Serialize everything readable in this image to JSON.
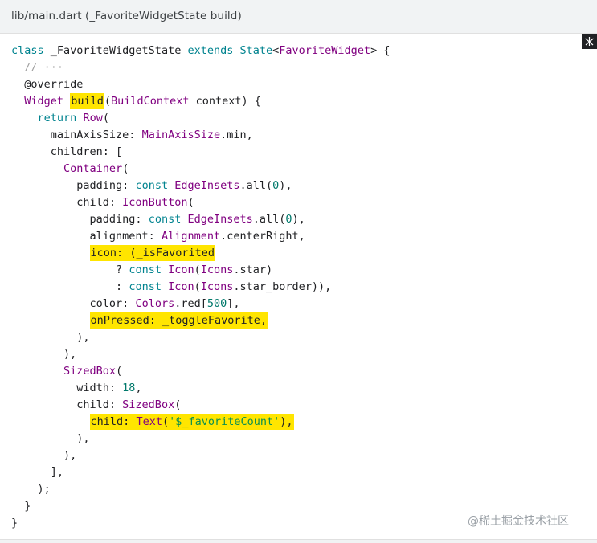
{
  "header": {
    "title": "lib/main.dart (_FavoriteWidgetState build)"
  },
  "copy_button": {
    "icon": "copy-icon"
  },
  "watermark": {
    "text": "@稀土掘金技术社区"
  },
  "code": {
    "l1": {
      "kw1": "class",
      "name": " _FavoriteWidgetState ",
      "kw2": "extends",
      "sp": " ",
      "ty1": "State",
      "lt": "<",
      "ty2": "FavoriteWidget",
      "end": "> {"
    },
    "l2": {
      "comment": "  // ···"
    },
    "l3": {
      "text": "  @override"
    },
    "l4": {
      "indent": "  ",
      "ty": "Widget",
      "sp": " ",
      "hl": "build",
      "open": "(",
      "ty2": "BuildContext",
      "end": " context) {"
    },
    "l5": {
      "indent": "    ",
      "kw": "return",
      "sp": " ",
      "ty": "Row",
      "end": "("
    },
    "l6": {
      "indent": "      mainAxisSize: ",
      "ty": "MainAxisSize",
      "end": ".min,"
    },
    "l7": {
      "text": "      children: ["
    },
    "l8": {
      "indent": "        ",
      "ty": "Container",
      "end": "("
    },
    "l9": {
      "indent": "          padding: ",
      "kw": "const",
      "sp": " ",
      "ty": "EdgeInsets",
      "mid": ".all(",
      "num": "0",
      "end": "),"
    },
    "l10": {
      "indent": "          child: ",
      "ty": "IconButton",
      "end": "("
    },
    "l11": {
      "indent": "            padding: ",
      "kw": "const",
      "sp": " ",
      "ty": "EdgeInsets",
      "mid": ".all(",
      "num": "0",
      "end": "),"
    },
    "l12": {
      "indent": "            alignment: ",
      "ty": "Alignment",
      "end": ".centerRight,"
    },
    "l13": {
      "indent": "            ",
      "hl": "icon: (_isFavorited"
    },
    "l14": {
      "indent": "                ? ",
      "kw": "const",
      "sp": " ",
      "ty": "Icon",
      "open": "(",
      "ty2": "Icons",
      "end": ".star)"
    },
    "l15": {
      "indent": "                : ",
      "kw": "const",
      "sp": " ",
      "ty": "Icon",
      "open": "(",
      "ty2": "Icons",
      "end": ".star_border)),"
    },
    "l16": {
      "indent": "            color: ",
      "ty": "Colors",
      "mid": ".red[",
      "num": "500",
      "end": "],"
    },
    "l17": {
      "indent": "            ",
      "hl": "onPressed: _toggleFavorite,"
    },
    "l18": {
      "text": "          ),"
    },
    "l19": {
      "text": "        ),"
    },
    "l20": {
      "indent": "        ",
      "ty": "SizedBox",
      "end": "("
    },
    "l21": {
      "indent": "          width: ",
      "num": "18",
      "end": ","
    },
    "l22": {
      "indent": "          child: ",
      "ty": "SizedBox",
      "end": "("
    },
    "l23": {
      "indent": "            ",
      "hl1": "child: ",
      "hl_ty": "Text",
      "hl2": "(",
      "hl_str": "'$_favoriteCount'",
      "hl3": "),"
    },
    "l24": {
      "text": "          ),"
    },
    "l25": {
      "text": "        ),"
    },
    "l26": {
      "text": "      ],"
    },
    "l27": {
      "text": "    );"
    },
    "l28": {
      "text": "  }"
    },
    "l29": {
      "text": "}"
    }
  }
}
